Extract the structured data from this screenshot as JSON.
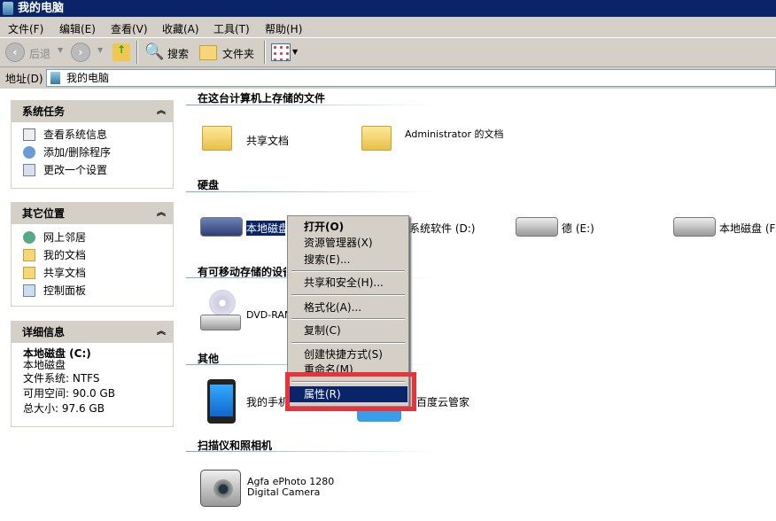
{
  "window": {
    "title": "我的电脑"
  },
  "menu": [
    "文件(F)",
    "编辑(E)",
    "查看(V)",
    "收藏(A)",
    "工具(T)",
    "帮助(H)"
  ],
  "toolbar": {
    "back": "后退",
    "search": "搜索",
    "folders": "文件夹"
  },
  "address": {
    "label": "地址(D)",
    "value": "我的电脑"
  },
  "panels": {
    "system_tasks": {
      "title": "系统任务",
      "items": [
        "查看系统信息",
        "添加/删除程序",
        "更改一个设置"
      ]
    },
    "other_places": {
      "title": "其它位置",
      "items": [
        "网上邻居",
        "我的文档",
        "共享文档",
        "控制面板"
      ]
    },
    "details": {
      "title": "详细信息",
      "name": "本地磁盘 (C:)",
      "type": "本地磁盘",
      "fs": "文件系统: NTFS",
      "free": "可用空间: 90.0 GB",
      "total": "总大小: 97.6 GB"
    }
  },
  "sections": {
    "files": {
      "title": "在这台计算机上存储的文件",
      "items": [
        "共享文档",
        "Administrator 的文档"
      ]
    },
    "drives": {
      "title": "硬盘",
      "items": [
        "本地磁盘 (C:)",
        "系统软件 (D:)",
        "德 (E:)",
        "本地磁盘 (F:)"
      ]
    },
    "removable": {
      "title": "有可移动存储的设备",
      "items": [
        "DVD-RAM 驱动器"
      ]
    },
    "other": {
      "title": "其他",
      "items": [
        "我的手机",
        "百度云管家"
      ]
    },
    "scanners": {
      "title": "扫描仪和照相机",
      "items": [
        "Agfa ePhoto 1280",
        "Digital Camera"
      ]
    }
  },
  "context_menu": [
    "打开(O)",
    "资源管理器(X)",
    "搜索(E)...",
    "共享和安全(H)...",
    "格式化(A)...",
    "复制(C)",
    "创建快捷方式(S)",
    "重命名(M)",
    "属性(R)"
  ],
  "colors": {
    "title": "#0a246a",
    "highlight": "#0a246a",
    "annotation": "#e8333a"
  }
}
